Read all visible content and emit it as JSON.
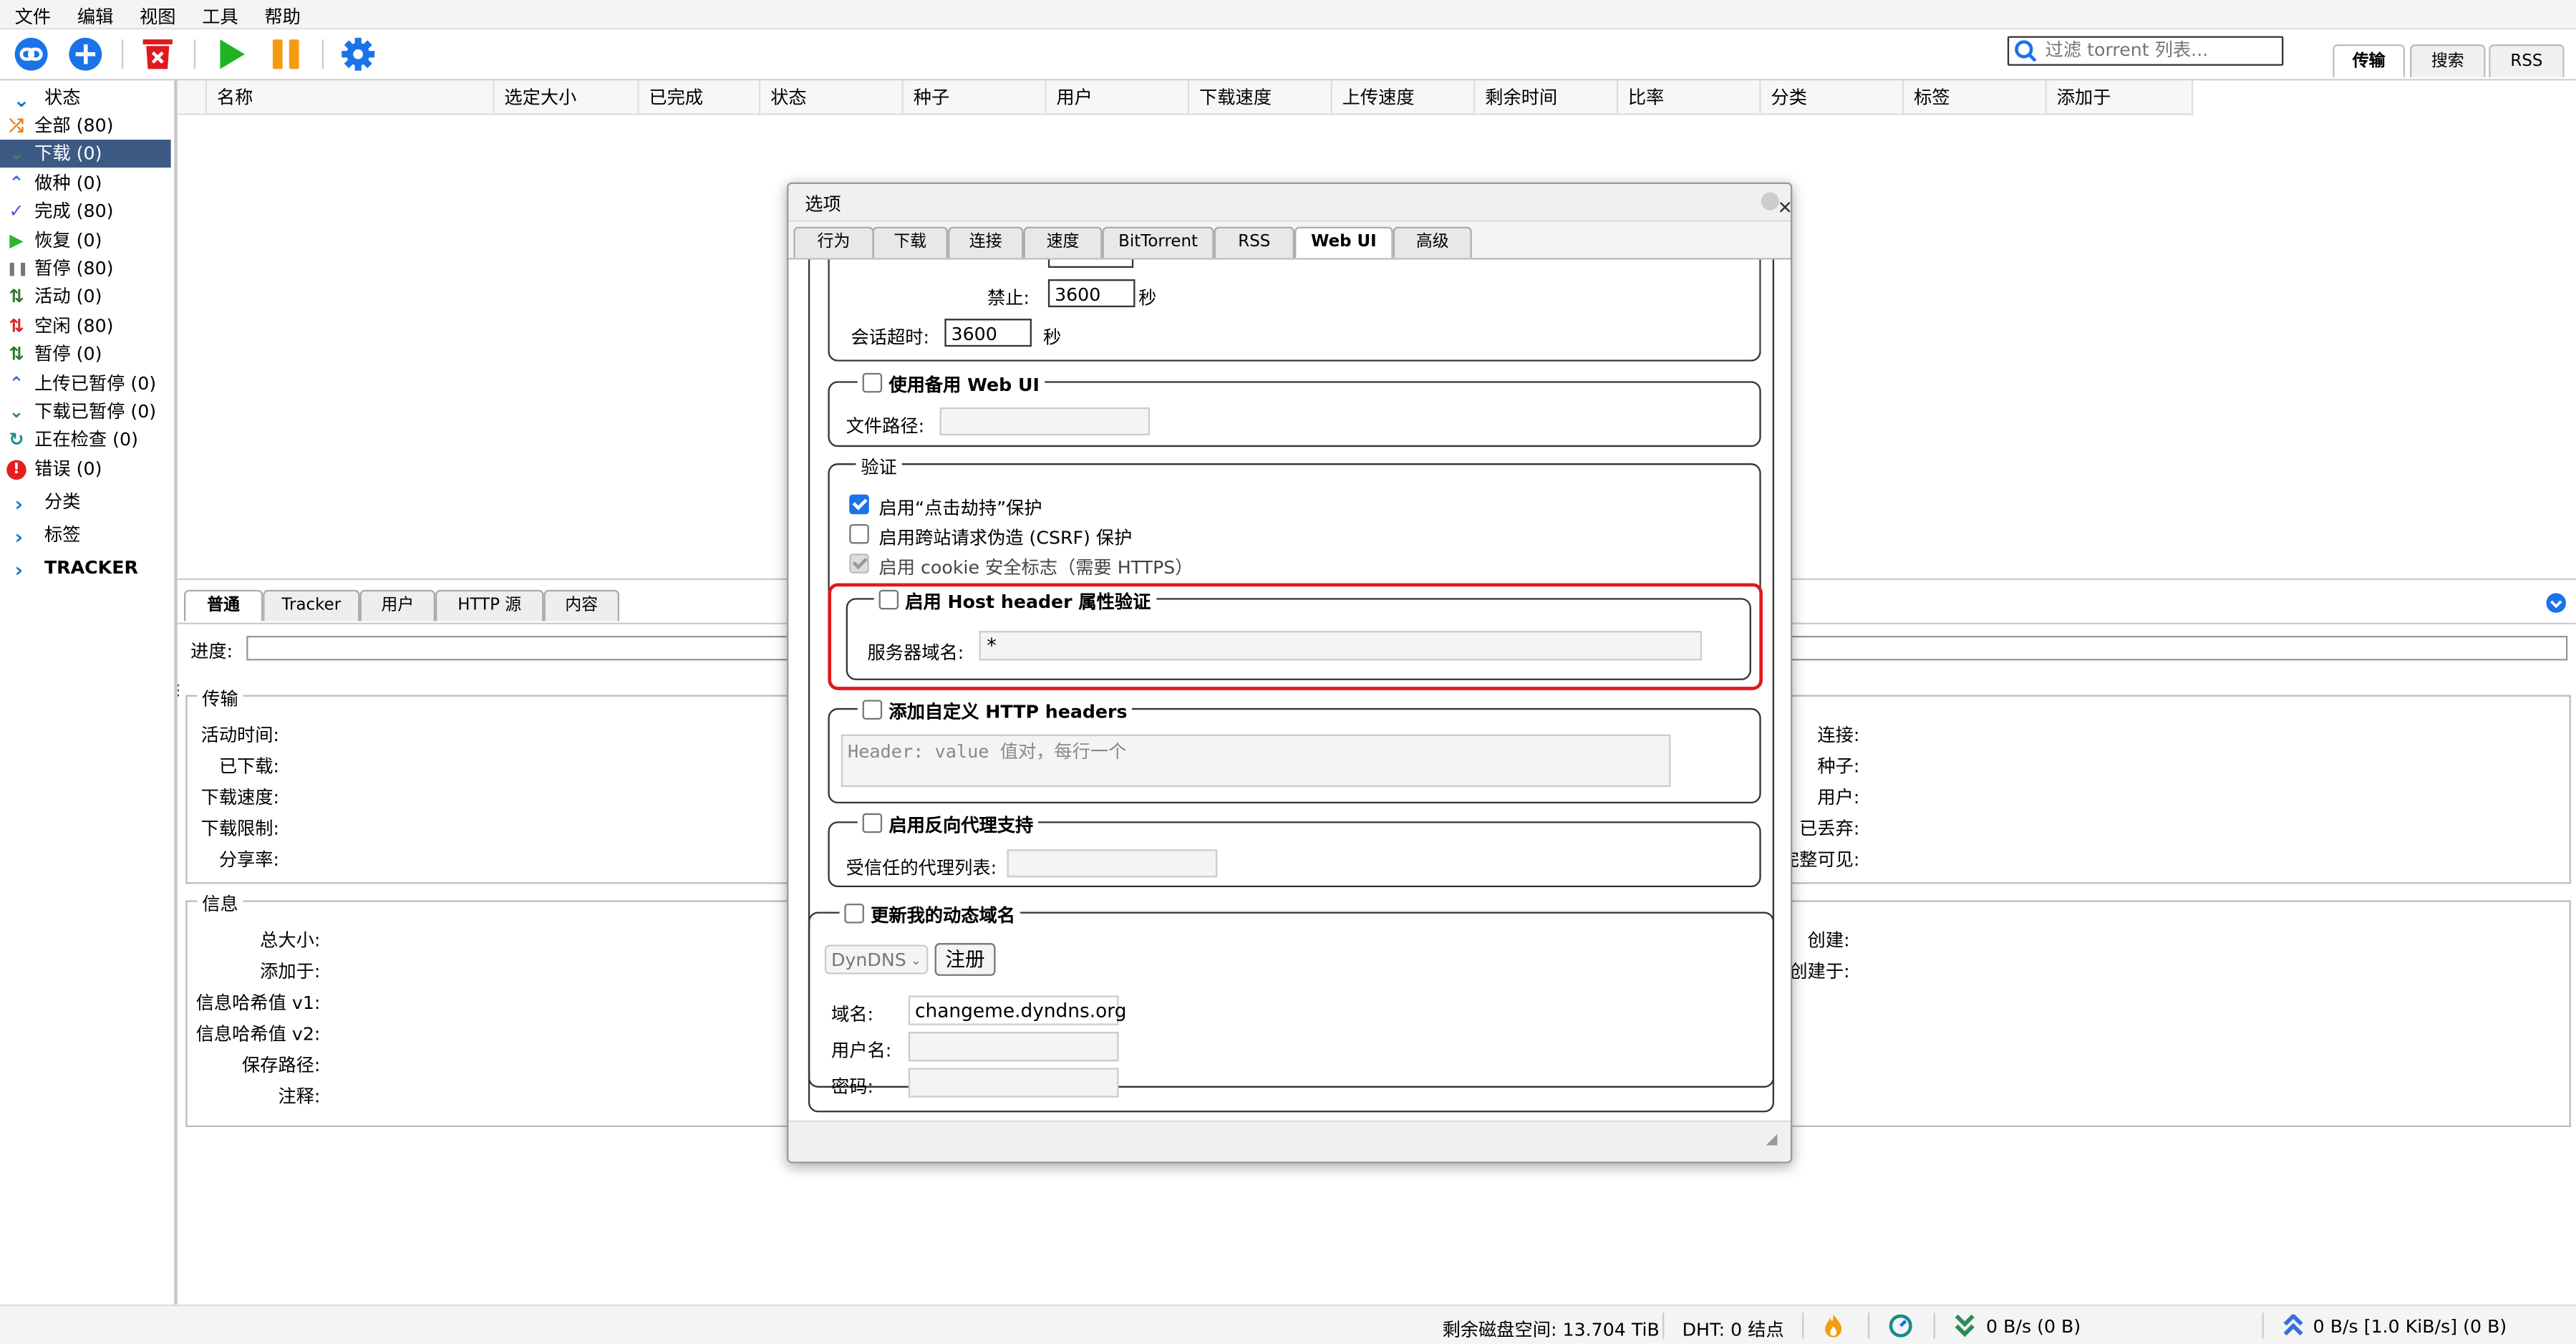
{
  "menu": [
    "文件",
    "编辑",
    "视图",
    "工具",
    "帮助"
  ],
  "search": {
    "placeholder": "过滤 torrent 列表..."
  },
  "top_tabs": [
    "传输",
    "搜索",
    "RSS"
  ],
  "sidebar": {
    "status_header": "状态",
    "items": [
      {
        "label": "全部 (80)",
        "icon": "shuffle-icon",
        "color": "#e67e22"
      },
      {
        "label": "下载 (0)",
        "icon": "download-icon",
        "color": "#2e8b57",
        "selected": true
      },
      {
        "label": "做种 (0)",
        "icon": "seeding-icon",
        "color": "#3a6fd8"
      },
      {
        "label": "完成 (80)",
        "icon": "check-icon",
        "color": "#7b3fd6"
      },
      {
        "label": "恢复 (0)",
        "icon": "play-icon",
        "color": "#2bb52b"
      },
      {
        "label": "暂停 (80)",
        "icon": "pause-icon",
        "color": "#777777"
      },
      {
        "label": "活动 (0)",
        "icon": "active-icon",
        "color": "#2a7a2a"
      },
      {
        "label": "空闲 (80)",
        "icon": "inactive-icon",
        "color": "#e02020"
      },
      {
        "label": "暂停 (0)",
        "icon": "stalled-icon",
        "color": "#2a7a2a"
      },
      {
        "label": "上传已暂停 (0)",
        "icon": "upload-stalled-icon",
        "color": "#3a6fd8"
      },
      {
        "label": "下载已暂停 (0)",
        "icon": "download-stalled-icon",
        "color": "#2e8b57"
      },
      {
        "label": "正在检查 (0)",
        "icon": "checking-icon",
        "color": "#1a8a8a"
      },
      {
        "label": "错误 (0)",
        "icon": "error-icon",
        "color": "#e02020"
      }
    ],
    "categories": "分类",
    "tags": "标签",
    "trackers": "TRACKER"
  },
  "columns": [
    "名称",
    "选定大小",
    "已完成",
    "状态",
    "种子",
    "用户",
    "下载速度",
    "上传速度",
    "剩余时间",
    "比率",
    "分类",
    "标签",
    "添加于"
  ],
  "properties": {
    "tabs": [
      "普通",
      "Tracker",
      "用户",
      "HTTP 源",
      "内容"
    ],
    "progress_label": "进度:",
    "transfer": {
      "legend": "传输",
      "left": [
        "活动时间:",
        "已下载:",
        "下载速度:",
        "下载限制:",
        "分享率:"
      ],
      "right": [
        "连接:",
        "种子:",
        "用户:",
        "已丢弃:",
        "完整可见:"
      ]
    },
    "info": {
      "legend": "信息",
      "left": [
        "总大小:",
        "添加于:",
        "信息哈希值 v1:",
        "信息哈希值 v2:",
        "保存路径:",
        "注释:"
      ],
      "right": [
        "创建:",
        "创建于:"
      ]
    }
  },
  "status": {
    "disk": "剩余磁盘空间: 13.704 TiB",
    "dht": "DHT: 0 结点",
    "down": "0 B/s (0 B)",
    "up": "0 B/s [1.0 KiB/s] (0 B)"
  },
  "dialog": {
    "title": "选项",
    "tabs": [
      "行为",
      "下载",
      "连接",
      "速度",
      "BitTorrent",
      "RSS",
      "Web UI",
      "高级"
    ],
    "active_tab": "Web UI",
    "ban_label": "禁止:",
    "ban_value": "3600",
    "ban_unit": "秒",
    "session_label": "会话超时:",
    "session_value": "3600",
    "session_unit": "秒",
    "alt_webui": {
      "legend": "使用备用 Web UI",
      "path_label": "文件路径:",
      "path_value": ""
    },
    "auth": {
      "legend": "验证",
      "clickjacking": "启用“点击劫持”保护",
      "csrf": "启用跨站请求伪造 (CSRF) 保护",
      "cookie": "启用 cookie 安全标志（需要 HTTPS）"
    },
    "host_header": {
      "legend": "启用 Host header 属性验证",
      "label": "服务器域名:",
      "value": "*"
    },
    "custom_headers": {
      "legend": "添加自定义 HTTP headers",
      "placeholder": "Header: value 值对，每行一个"
    },
    "reverse_proxy": {
      "legend": "启用反向代理支持",
      "label": "受信任的代理列表:",
      "value": ""
    },
    "dyndns": {
      "legend": "更新我的动态域名",
      "service": "DynDNS",
      "register": "注册",
      "domain_label": "域名:",
      "domain_value": "changeme.dyndns.org",
      "user_label": "用户名:",
      "pass_label": "密码:"
    }
  },
  "colors": {
    "accent": "#1a73e8",
    "highlight": "#e0191e",
    "selected": "#3d5a85"
  }
}
